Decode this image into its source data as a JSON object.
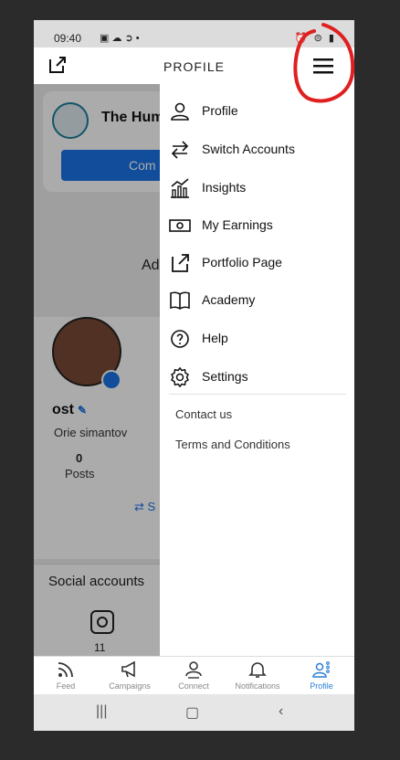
{
  "statusbar": {
    "time": "09:40"
  },
  "header": {
    "title": "PROFILE"
  },
  "background": {
    "org_name": "The Huma",
    "card_button": "Com",
    "add_text": "Ad",
    "username": "ost",
    "full_name": "Orie simantov",
    "posts_count": "0",
    "posts_label": "Posts",
    "switch_fragment": "⇄ S",
    "social_title": "Social accounts",
    "instagram_count": "11"
  },
  "menu": {
    "items": [
      {
        "label": "Profile",
        "icon": "person-icon"
      },
      {
        "label": "Switch Accounts",
        "icon": "swap-arrows-icon"
      },
      {
        "label": "Insights",
        "icon": "chart-icon"
      },
      {
        "label": "My Earnings",
        "icon": "banknote-icon"
      },
      {
        "label": "Portfolio Page",
        "icon": "external-link-icon"
      },
      {
        "label": "Academy",
        "icon": "book-icon"
      },
      {
        "label": "Help",
        "icon": "question-icon"
      },
      {
        "label": "Settings",
        "icon": "gear-icon"
      }
    ],
    "links": [
      "Contact us",
      "Terms and Conditions"
    ]
  },
  "bottom_nav": [
    {
      "label": "Feed",
      "icon": "rss-icon"
    },
    {
      "label": "Campaigns",
      "icon": "megaphone-icon"
    },
    {
      "label": "Connect",
      "icon": "connect-icon"
    },
    {
      "label": "Notifications",
      "icon": "bell-icon"
    },
    {
      "label": "Profile",
      "icon": "profile-icon",
      "active": true
    }
  ],
  "colors": {
    "accent": "#1a73e8",
    "active_nav": "#2a7fd6",
    "annotation": "#e02020"
  }
}
